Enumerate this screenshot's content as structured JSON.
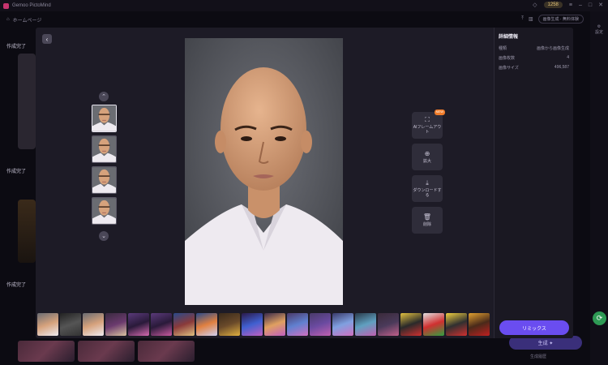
{
  "window": {
    "title": "Gemoo PictoMind"
  },
  "titlebar": {
    "credits": "1258"
  },
  "nav": {
    "home_label": "ホームページ",
    "right_pill": "画像生成 · 無料体験"
  },
  "sidebar_right": {
    "label": "設定"
  },
  "background": {
    "section1": "作成完了",
    "section2": "作成完了",
    "section3": "作成完了",
    "right_button": "生成 ✦",
    "right_note": "生成履歴"
  },
  "modal": {
    "tools": [
      {
        "id": "ai-frame",
        "icon": "⛶",
        "label": "AIフレームアウト",
        "badge": "NEW"
      },
      {
        "id": "zoom",
        "icon": "⊕",
        "label": "拡大"
      },
      {
        "id": "download",
        "icon": "⤓",
        "label": "ダウンロードする"
      },
      {
        "id": "delete",
        "icon": "🗑",
        "label": "削除"
      }
    ],
    "info": {
      "title": "詳細情報",
      "rows": [
        {
          "key": "種類",
          "value": "画像から画像生成"
        },
        {
          "key": "画像枚数",
          "value": "4"
        },
        {
          "key": "画像サイズ",
          "value": "496,587"
        }
      ]
    },
    "remix_label": "リミックス",
    "thumb_count": 4,
    "strip_count": 20
  },
  "colors": {
    "accent": "#6a4df0",
    "badge": "#f07c2a",
    "panel": "#1d1b26"
  }
}
